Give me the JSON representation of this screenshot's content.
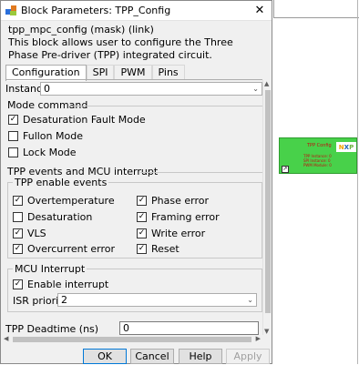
{
  "dialog": {
    "title": "Block Parameters: TPP_Config",
    "close_glyph": "✕",
    "mask_type": "tpp_mpc_config (mask) (link)",
    "description": "This block allows user to configure the Three Phase Pre-driver (TPP) integrated circuit."
  },
  "tabs": [
    {
      "label": "Configuration",
      "active": true
    },
    {
      "label": "SPI",
      "active": false
    },
    {
      "label": "PWM",
      "active": false
    },
    {
      "label": "Pins",
      "active": false
    }
  ],
  "instance": {
    "label": "Instance",
    "value": "0"
  },
  "mode_command": {
    "title": "Mode command",
    "desaturation_fault_mode": {
      "label": "Desaturation Fault Mode",
      "checked": true
    },
    "fullon_mode": {
      "label": "Fullon Mode",
      "checked": false
    },
    "lock_mode": {
      "label": "Lock Mode",
      "checked": false
    }
  },
  "tpp_events": {
    "title": "TPP events and MCU interrupt",
    "enable_events": {
      "title": "TPP enable events",
      "overtemperature": {
        "label": "Overtemperature",
        "checked": true
      },
      "phase_error": {
        "label": "Phase error",
        "checked": true
      },
      "desaturation": {
        "label": "Desaturation",
        "checked": false
      },
      "framing_error": {
        "label": "Framing error",
        "checked": true
      },
      "vls": {
        "label": "VLS",
        "checked": true
      },
      "write_error": {
        "label": "Write error",
        "checked": true
      },
      "overcurrent_error": {
        "label": "Overcurrent error",
        "checked": true
      },
      "reset": {
        "label": "Reset",
        "checked": true
      }
    },
    "mcu_interrupt": {
      "title": "MCU Interrupt",
      "enable_interrupt": {
        "label": "Enable interrupt",
        "checked": true
      },
      "isr_priority": {
        "label": "ISR priority",
        "value": "2"
      }
    }
  },
  "deadtime": {
    "label": "TPP Deadtime (ns)",
    "value": "0"
  },
  "buttons": {
    "ok": "OK",
    "cancel": "Cancel",
    "help": "Help",
    "apply": "Apply"
  },
  "canvas_block": {
    "title": "TPP Config",
    "lines": [
      "TPP Instance: 0",
      "SPI Instance: 0",
      "PWM Module: 0"
    ],
    "logo": "NXP"
  },
  "icons": {
    "chevron_down": "⌄",
    "scroll_up": "▲",
    "scroll_down": "▼",
    "scroll_left": "◀",
    "scroll_right": "▶",
    "link": "↗"
  },
  "colors": {
    "block_green": "#48d14a",
    "block_text_red": "#c01010",
    "default_button_border": "#0078d7"
  }
}
